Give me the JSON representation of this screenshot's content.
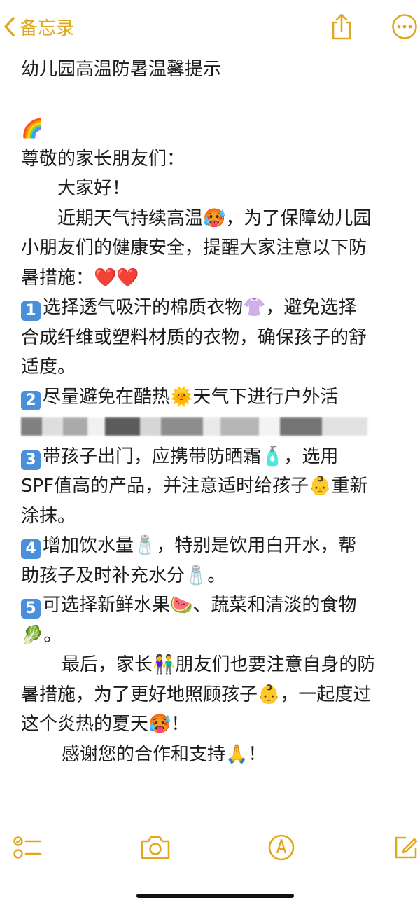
{
  "nav": {
    "back_label": "备忘录",
    "accent_color": "#e0a81e",
    "icons": [
      "chevron-left-icon",
      "share-icon",
      "more-icon"
    ]
  },
  "note": {
    "title": "幼儿园高温防暑温馨提示",
    "rainbow_emoji": "🌈",
    "greeting": "尊敬的家长朋友们：",
    "hello": "大家好！",
    "intro_1a": "近期天气持续高温",
    "emoji_hot": "🥵",
    "intro_1b": "，为了保障幼儿园",
    "intro_2": "小朋友们的健康安全，提醒大家注意以下防",
    "intro_3": "暑措施：",
    "hearts": "❤️❤️",
    "tip1_num": "1",
    "tip1_a": "选择透气吸汗的棉质衣物",
    "emoji_shirt": "👚",
    "tip1_b": "，避免选择",
    "tip1_c": "合成纤维或塑料材质的衣物，确保孩子的舒",
    "tip1_d": "适度。",
    "tip2_num": "2",
    "tip2_a": "尽量避免在酷热",
    "emoji_sun": "🌞",
    "tip2_b": "天气下进行户外活",
    "tip3_num": "3",
    "tip3_a": "带孩子出门，应携带防晒霜",
    "emoji_lotion": "🧴",
    "tip3_b": "，选用",
    "tip3_c": "SPF值高的产品，并注意适时给孩子",
    "emoji_baby": "👶",
    "tip3_d": "重新",
    "tip3_e": "涂抹。",
    "tip4_num": "4",
    "tip4_a": "增加饮水量",
    "emoji_water": "🧂",
    "tip4_b": "，特别是饮用白开水，帮",
    "tip4_c": "助孩子及时补充水分",
    "tip4_d": "。",
    "tip5_num": "5",
    "tip5_a": "可选择新鲜水果",
    "emoji_melon": "🍉",
    "tip5_b": "、蔬菜和清淡的食物",
    "emoji_leaf": "🥬",
    "tip5_c": "。",
    "closing_a": "最后，家长",
    "emoji_couple": "👫",
    "closing_b": "朋友们也要注意自身的防",
    "closing_c": "暑措施，为了更好地照顾孩子",
    "closing_d": "，一起度过",
    "closing_e": "这个炎热的夏天",
    "closing_f": "！",
    "thanks_a": "感谢您的合作和支持",
    "emoji_pray": "🙏",
    "thanks_b": "！"
  },
  "toolbar": {
    "icons": [
      "checklist-icon",
      "camera-icon",
      "markup-icon",
      "compose-icon"
    ]
  }
}
